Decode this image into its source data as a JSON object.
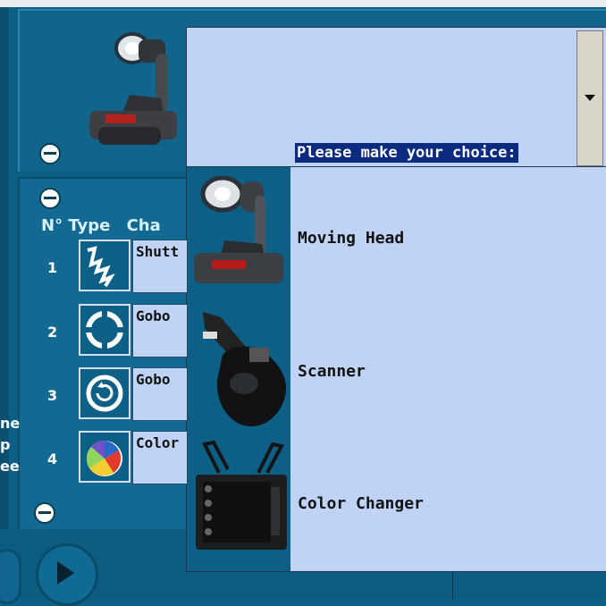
{
  "dropdown": {
    "prompt": "Please make your choice:",
    "options": [
      {
        "label": "Moving Head",
        "icon": "moving-head-icon"
      },
      {
        "label": "Scanner",
        "icon": "scanner-icon"
      },
      {
        "label": "Color Changer",
        "icon": "color-changer-icon"
      }
    ]
  },
  "table": {
    "header": "N° Type",
    "header_suffix": "Cha",
    "rows": [
      {
        "num": "1",
        "icon": "shutter-icon",
        "channel": "Shutt"
      },
      {
        "num": "2",
        "icon": "gobo-icon",
        "channel": "Gobo"
      },
      {
        "num": "3",
        "icon": "gobo-rotation-icon",
        "channel": "Gobo"
      },
      {
        "num": "4",
        "icon": "color-wheel-icon",
        "channel": "Color"
      }
    ]
  },
  "left_fragments": [
    "ne",
    "p",
    "ee"
  ]
}
